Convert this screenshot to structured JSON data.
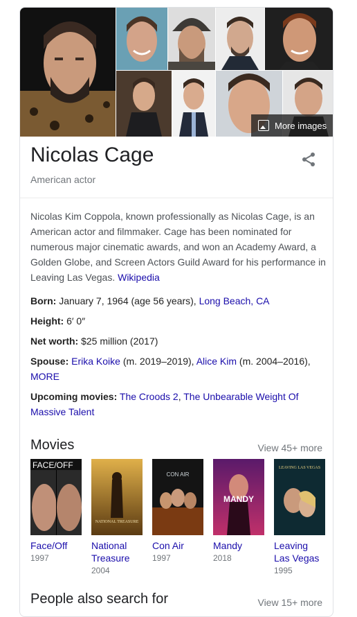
{
  "gallery": {
    "more_images_label": "More images"
  },
  "entity": {
    "name": "Nicolas Cage",
    "type": "American actor"
  },
  "description": {
    "text": "Nicolas Kim Coppola, known professionally as Nicolas Cage, is an American actor and filmmaker. Cage has been nominated for numerous major cinematic awards, and won an Academy Award, a Golden Globe, and Screen Actors Guild Award for his performance in Leaving Las Vegas. ",
    "source": "Wikipedia"
  },
  "facts": {
    "born_label": "Born:",
    "born_text": " January 7, 1964 (age 56 years), ",
    "born_place": "Long Beach, CA",
    "height_label": "Height:",
    "height_value": " 6′ 0″",
    "net_worth_label": "Net worth:",
    "net_worth_value": " $25 million (2017)",
    "spouse_label": "Spouse:",
    "spouse1_name": "Erika Koike",
    "spouse1_dates": " (m. 2019–2019), ",
    "spouse2_name": "Alice Kim",
    "spouse2_dates": " (m. 2004–2016),",
    "spouse_more": "MORE",
    "upcoming_label": "Upcoming movies:",
    "upcoming1": "The Croods 2",
    "upcoming_sep": ", ",
    "upcoming2": "The Unbearable Weight Of Massive Talent"
  },
  "movies": {
    "heading": "Movies",
    "view_more": "View 45+ more",
    "items": [
      {
        "title": "Face/Off",
        "year": "1997",
        "poster_text": "FACE/OFF"
      },
      {
        "title": "National Treasure",
        "year": "2004",
        "poster_text": "NATIONAL TREASURE"
      },
      {
        "title": "Con Air",
        "year": "1997",
        "poster_text": "CON AIR"
      },
      {
        "title": "Mandy",
        "year": "2018",
        "poster_text": "MANDY"
      },
      {
        "title": "Leaving Las Vegas",
        "year": "1995",
        "poster_text": "LEAVING LAS VEGAS"
      }
    ]
  },
  "people": {
    "heading": "People also search for",
    "view_more": "View 15+ more"
  },
  "colors": {
    "link": "#1a0dab",
    "muted": "#70757a",
    "border": "#dfe1e5"
  }
}
